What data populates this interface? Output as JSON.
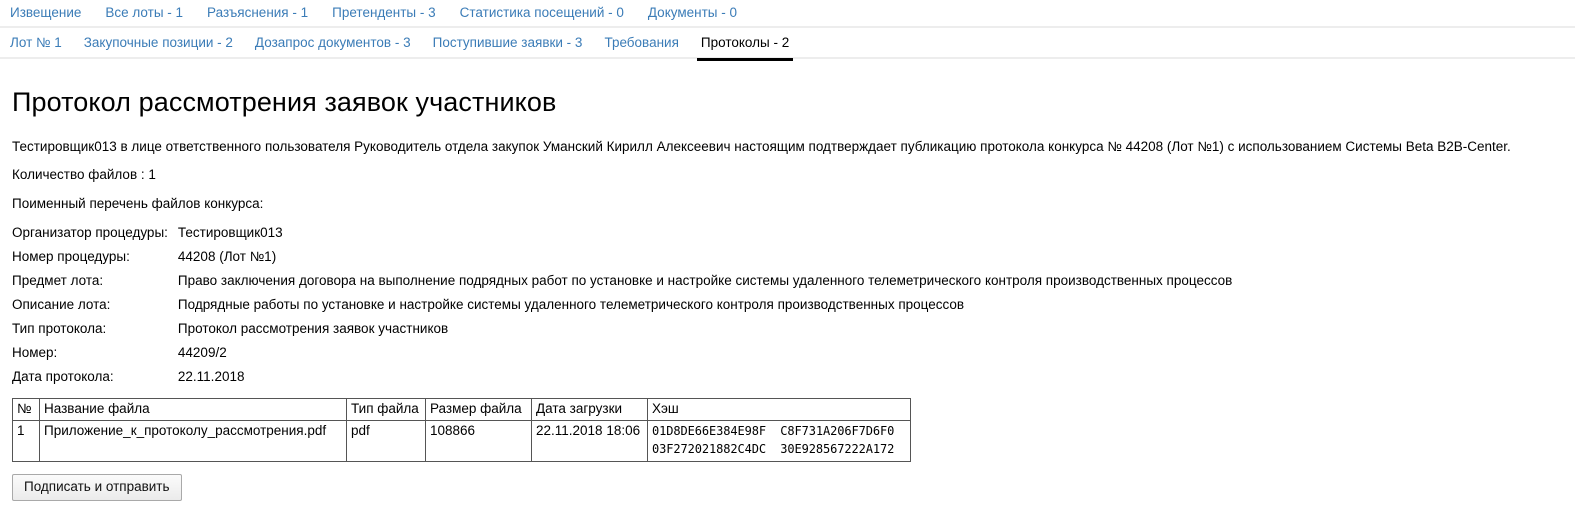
{
  "nav_primary": {
    "items": [
      {
        "label": "Извещение",
        "active": false
      },
      {
        "label": "Все лоты - 1",
        "active": false
      },
      {
        "label": "Разъяснения - 1",
        "active": false
      },
      {
        "label": "Претенденты - 3",
        "active": false
      },
      {
        "label": "Статистика посещений - 0",
        "active": false
      },
      {
        "label": "Документы - 0",
        "active": false
      }
    ]
  },
  "nav_secondary": {
    "items": [
      {
        "label": "Лот № 1",
        "active": false
      },
      {
        "label": "Закупочные позиции - 2",
        "active": false
      },
      {
        "label": "Дозапрос документов - 3",
        "active": false
      },
      {
        "label": "Поступившие заявки - 3",
        "active": false
      },
      {
        "label": "Требования",
        "active": false
      },
      {
        "label": "Протоколы - 2",
        "active": true
      }
    ]
  },
  "main": {
    "title": "Протокол рассмотрения заявок участников",
    "intro": "Тестировщик013 в лице ответственного пользователя Руководитель отдела закупок Уманский Кирилл Алексеевич настоящим подтверждает публикацию протокола конкурса № 44208 (Лот №1) с использованием Системы Beta B2B-Center.",
    "files_count": "Количество файлов : 1",
    "files_list_caption": "Поименный перечень файлов конкурса:",
    "details": [
      {
        "label": "Организатор процедуры:",
        "value": "Тестировщик013"
      },
      {
        "label": "Номер процедуры:",
        "value": "44208 (Лот №1)"
      },
      {
        "label": "Предмет лота:",
        "value": "Право заключения договора на выполнение подрядных работ по установке и настройке системы удаленного телеметрического контроля производственных процессов"
      },
      {
        "label": "Описание лота:",
        "value": "Подрядные работы по установке и настройке системы удаленного телеметрического контроля производственных процессов"
      },
      {
        "label": "Тип протокола:",
        "value": "Протокол рассмотрения заявок участников"
      },
      {
        "label": "Номер:",
        "value": "44209/2"
      },
      {
        "label": "Дата протокола:",
        "value": "22.11.2018"
      }
    ],
    "files_table": {
      "headers": [
        "№",
        "Название файла",
        "Тип файла",
        "Размер файла",
        "Дата загрузки",
        "Хэш"
      ],
      "rows": [
        {
          "num": "1",
          "name": "Приложение_к_протоколу_рассмотрения.pdf",
          "type": "pdf",
          "size": "108866",
          "date": "22.11.2018 18:06",
          "hash_line1": "01D8DE66E384E98F  C8F731A206F7D6F0",
          "hash_line2": "03F272021882C4DC  30E928567222A172"
        }
      ]
    },
    "submit_label": "Подписать и отправить"
  },
  "colors": {
    "link": "#3b7cb7",
    "active_tab_underline": "#000000",
    "divider": "#ededed",
    "table_border": "#555555"
  }
}
